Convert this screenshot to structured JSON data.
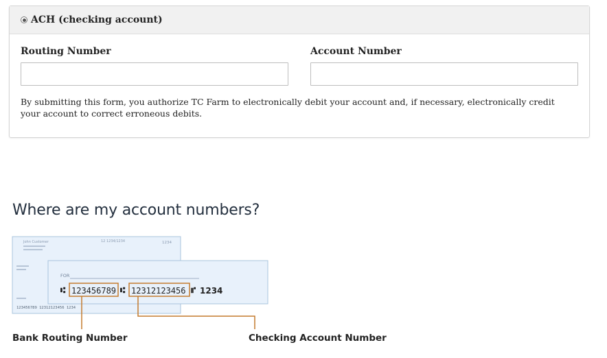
{
  "ach": {
    "option_label": "ACH (checking account)",
    "routing_label": "Routing Number",
    "routing_value": "",
    "account_label": "Account Number",
    "account_value": "",
    "disclaimer": "By submitting this form, you authorize TC Farm to electronically debit your account and, if necessary, electronically credit your account to correct erroneous debits."
  },
  "help": {
    "title": "Where are my account numbers?",
    "check_back_name": "John Customer",
    "check_back_date": "12 1234/1234",
    "check_back_number": "1234",
    "check_front_for": "FOR",
    "routing_number": "123456789",
    "account_number": "12312123456",
    "check_number": "1234",
    "back_micr": "123456789 12312123456 1234",
    "routing_caption": "Bank Routing Number",
    "account_caption": "Checking Account Number"
  },
  "colors": {
    "accent_line": "#c47a2c",
    "check_fill": "#e8f1fb",
    "check_border": "#a9c4dc"
  }
}
